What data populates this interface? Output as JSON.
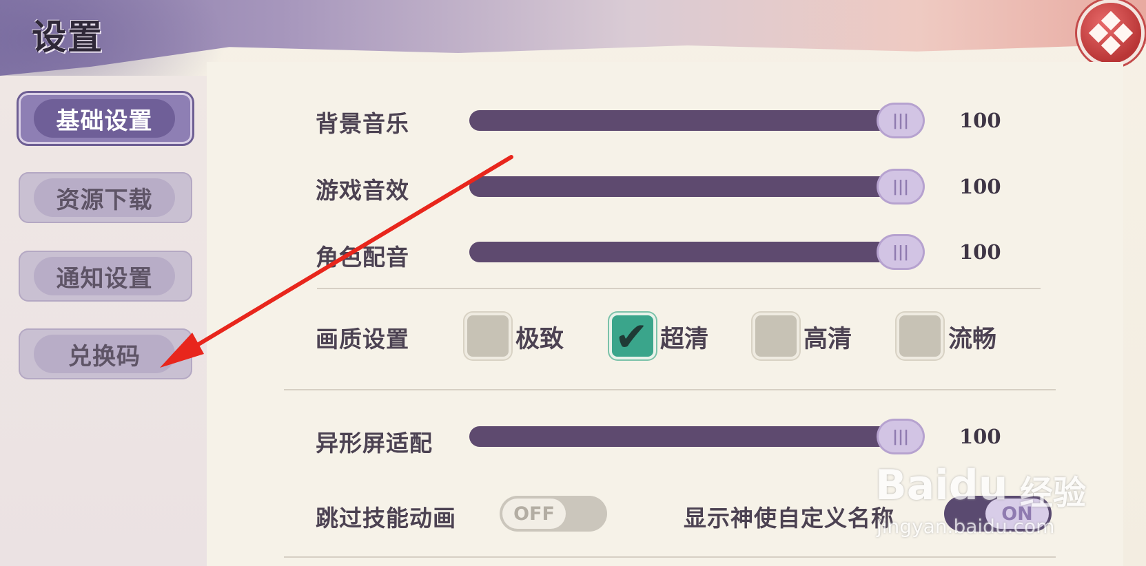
{
  "header": {
    "title": "设置"
  },
  "sidebar": {
    "items": [
      {
        "label": "基础设置",
        "active": true
      },
      {
        "label": "资源下载",
        "active": false
      },
      {
        "label": "通知设置",
        "active": false
      },
      {
        "label": "兑换码",
        "active": false
      }
    ]
  },
  "audio": {
    "bgm_label": "背景音乐",
    "bgm_value": "100",
    "sfx_label": "游戏音效",
    "sfx_value": "100",
    "voice_label": "角色配音",
    "voice_value": "100"
  },
  "quality": {
    "label": "画质设置",
    "options": [
      {
        "label": "极致",
        "checked": false
      },
      {
        "label": "超清",
        "checked": true
      },
      {
        "label": "高清",
        "checked": false
      },
      {
        "label": "流畅",
        "checked": false
      }
    ]
  },
  "screen_adapt": {
    "label": "异形屏适配",
    "value": "100"
  },
  "skip_skill_anim": {
    "label": "跳过技能动画",
    "state": "OFF"
  },
  "show_custom_name": {
    "label": "显示神使自定义名称",
    "state": "ON"
  },
  "watermark": {
    "brand": "Baidu",
    "sub": "经验",
    "url": "jingyan.baidu.com"
  },
  "colors": {
    "slider_fill": "#5e4a6f",
    "active_tab": "#6f5f98",
    "checkbox_checked": "#3aa58b",
    "close_button": "#c44b4b",
    "annotation_arrow": "#e8261c"
  }
}
